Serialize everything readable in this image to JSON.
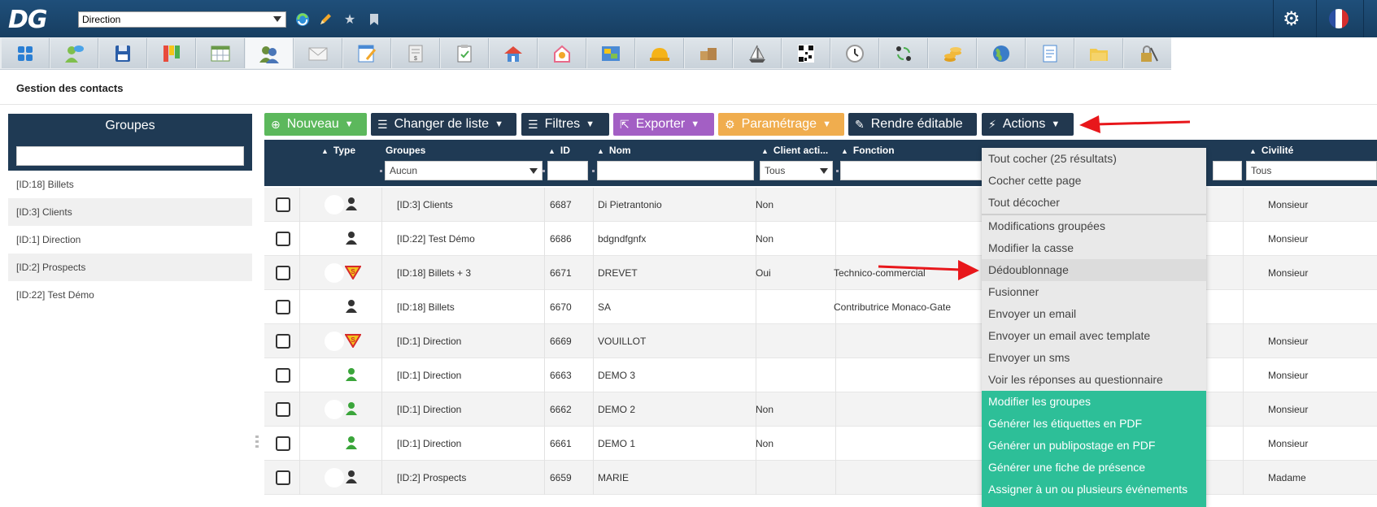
{
  "topbar": {
    "logo": "DG",
    "context_select": "Direction"
  },
  "page_title": "Gestion des contacts",
  "groups": {
    "title": "Groupes",
    "search_value": "",
    "items": [
      "[ID:18] Billets",
      "[ID:3] Clients",
      "[ID:1] Direction",
      "[ID:2] Prospects",
      "[ID:22] Test Démo"
    ]
  },
  "toolbar": {
    "nouveau": "Nouveau",
    "changer": "Changer de liste",
    "filtres": "Filtres",
    "exporter": "Exporter",
    "parametrage": "Paramétrage",
    "rendre": "Rendre éditable",
    "actions": "Actions"
  },
  "colors": {
    "green": "#5cb85c",
    "dark": "#22384f",
    "purple": "#a35fc4",
    "orange": "#f0ad4e",
    "menu_green": "#2dbf98",
    "header": "#1f3a54"
  },
  "table": {
    "headers": {
      "type": "Type",
      "groupes": "Groupes",
      "id": "ID",
      "nom": "Nom",
      "client": "Client acti...",
      "fonction": "Fonction",
      "civilite": "Civilité"
    },
    "filters": {
      "groupes": "Aucun",
      "client": "Tous",
      "civilite": "Tous"
    },
    "rows": [
      {
        "type": "person-dark",
        "group": "[ID:3] Clients",
        "id": "6687",
        "nom": "Di Pietrantonio",
        "client": "Non",
        "fonction": "",
        "civilite": "Monsieur"
      },
      {
        "type": "person-dark",
        "group": "[ID:22] Test Démo",
        "id": "6686",
        "nom": "bdgndfgnfx",
        "client": "Non",
        "fonction": "",
        "civilite": "Monsieur"
      },
      {
        "type": "superman",
        "group": "[ID:18] Billets + 3",
        "id": "6671",
        "nom": "DREVET",
        "client": "Oui",
        "fonction": "Technico-commercial",
        "civilite": "Monsieur"
      },
      {
        "type": "person-dark",
        "group": "[ID:18] Billets",
        "id": "6670",
        "nom": "SA",
        "client": "",
        "fonction": "Contributrice Monaco-Gate",
        "civilite": ""
      },
      {
        "type": "superman",
        "group": "[ID:1] Direction",
        "id": "6669",
        "nom": "VOUILLOT",
        "client": "",
        "fonction": "",
        "civilite": "Monsieur"
      },
      {
        "type": "person-green",
        "group": "[ID:1] Direction",
        "id": "6663",
        "nom": "DEMO 3",
        "client": "",
        "fonction": "",
        "civilite": "Monsieur"
      },
      {
        "type": "person-green",
        "group": "[ID:1] Direction",
        "id": "6662",
        "nom": "DEMO 2",
        "client": "Non",
        "fonction": "",
        "civilite": "Monsieur"
      },
      {
        "type": "person-green",
        "group": "[ID:1] Direction",
        "id": "6661",
        "nom": "DEMO 1",
        "client": "Non",
        "fonction": "",
        "civilite": "Monsieur"
      },
      {
        "type": "person-dark",
        "group": "[ID:2] Prospects",
        "id": "6659",
        "nom": "MARIE",
        "client": "",
        "fonction": "",
        "civilite": "Madame"
      }
    ]
  },
  "actions_menu": {
    "section1": [
      "Tout cocher (25 résultats)",
      "Cocher cette page",
      "Tout décocher"
    ],
    "section2": [
      "Modifications groupées",
      "Modifier la casse",
      "Dédoublonnage",
      "Fusionner",
      "Envoyer un email",
      "Envoyer un email avec template",
      "Envoyer un sms",
      "Voir les réponses au questionnaire"
    ],
    "section3": [
      "Modifier les groupes",
      "Générer les étiquettes en PDF",
      "Générer un publipostage en PDF",
      "Générer une fiche de présence",
      "Assigner à un ou plusieurs événements"
    ]
  }
}
